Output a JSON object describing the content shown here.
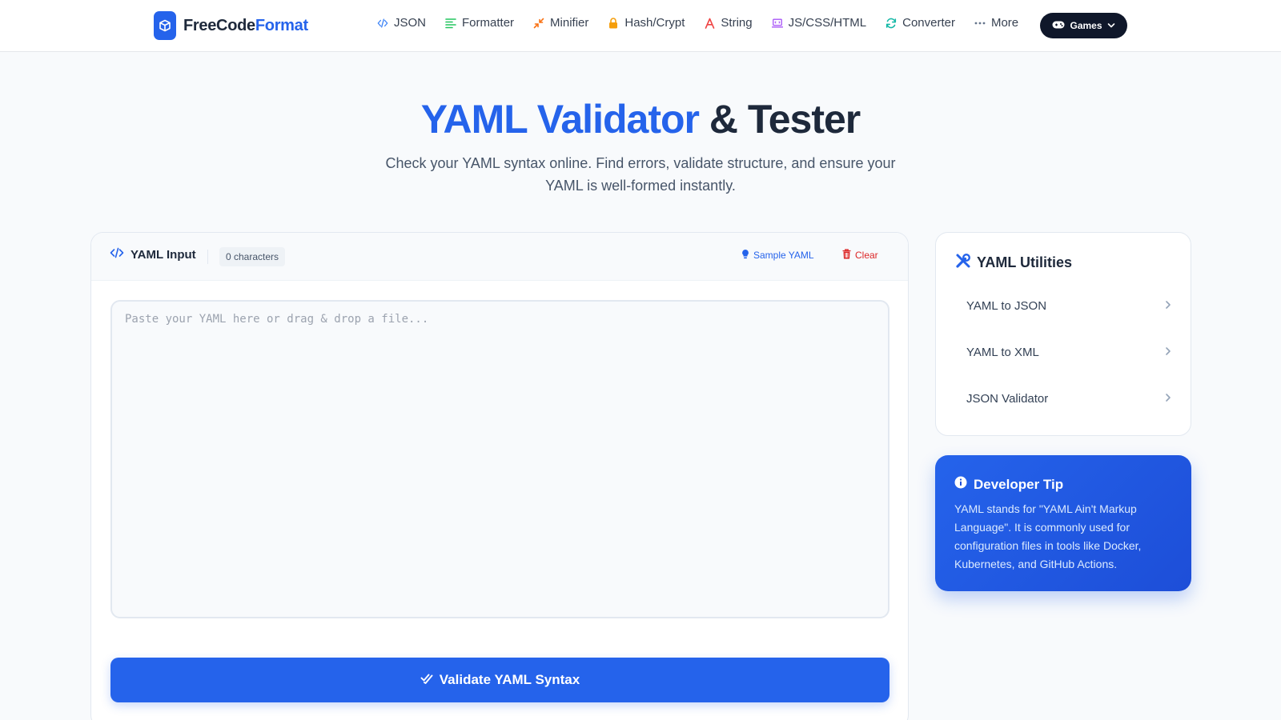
{
  "header": {
    "brand": {
      "part1": "FreeCode",
      "part2": "Format",
      "icon": "cube-logo-icon"
    },
    "nav": [
      {
        "label": "JSON",
        "icon": "code-icon",
        "color": "#3b82f6"
      },
      {
        "label": "Formatter",
        "icon": "align-left-icon",
        "color": "#22c55e"
      },
      {
        "label": "Minifier",
        "icon": "compress-icon",
        "color": "#f97316"
      },
      {
        "label": "Hash/Crypt",
        "icon": "lock-icon",
        "color": "#f59e0b"
      },
      {
        "label": "String",
        "icon": "font-icon",
        "color": "#ef4444"
      },
      {
        "label": "JS/CSS/HTML",
        "icon": "laptop-code-icon",
        "color": "#a855f7"
      },
      {
        "label": "Converter",
        "icon": "sync-icon",
        "color": "#14b8a6"
      },
      {
        "label": "More",
        "icon": "ellipsis-icon",
        "color": "#64748b"
      }
    ],
    "games_label": "Games"
  },
  "hero": {
    "title_accent": "YAML Validator",
    "title_rest": "& Tester",
    "subtitle": "Check your YAML syntax online. Find errors, validate structure, and ensure your YAML is well-formed instantly."
  },
  "editor": {
    "title": "YAML Input",
    "char_count": "0 characters",
    "sample_label": "Sample YAML",
    "clear_label": "Clear",
    "value": "",
    "placeholder": "Paste your YAML here or drag & drop a file...",
    "validate_label": "Validate YAML Syntax"
  },
  "utilities": {
    "title": "YAML Utilities",
    "items": [
      {
        "label": "YAML to JSON"
      },
      {
        "label": "YAML to XML"
      },
      {
        "label": "JSON Validator"
      }
    ]
  },
  "tip": {
    "title": "Developer Tip",
    "body": "YAML stands for \"YAML Ain't Markup Language\". It is commonly used for configuration files in tools like Docker, Kubernetes, and GitHub Actions."
  },
  "colors": {
    "accent": "#2563eb",
    "danger": "#dc2626",
    "dark": "#0f172a",
    "text": "#1e293b"
  }
}
